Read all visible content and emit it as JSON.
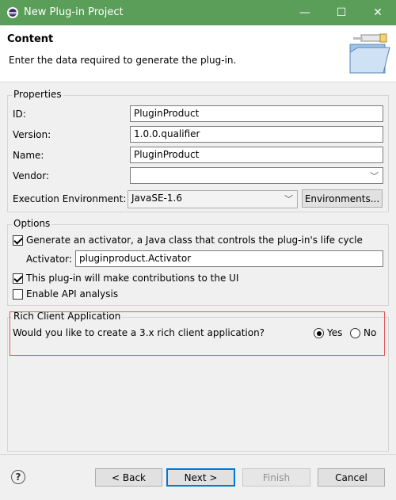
{
  "window": {
    "title": "New Plug-in Project",
    "minimize_glyph": "—",
    "maximize_glyph": "☐",
    "close_glyph": "✕"
  },
  "header": {
    "title": "Content",
    "description": "Enter the data required to generate the plug-in."
  },
  "properties": {
    "legend": "Properties",
    "id_label": "ID:",
    "id_value": "PluginProduct",
    "version_label": "Version:",
    "version_value": "1.0.0.qualifier",
    "name_label": "Name:",
    "name_value": "PluginProduct",
    "vendor_label": "Vendor:",
    "vendor_value": "",
    "exec_env_label": "Execution Environment:",
    "exec_env_value": "JavaSE-1.6",
    "environments_button": "Environments..."
  },
  "options": {
    "legend": "Options",
    "generate_activator_label": "Generate an activator, a Java class that controls the plug-in's life cycle",
    "generate_activator_checked": true,
    "activator_label": "Activator:",
    "activator_value": "pluginproduct.Activator",
    "ui_contrib_label": "This plug-in will make contributions to the UI",
    "ui_contrib_checked": true,
    "api_analysis_label": "Enable API analysis",
    "api_analysis_checked": false
  },
  "rcp": {
    "legend": "Rich Client Application",
    "question": "Would you like to create a 3.x rich client application?",
    "yes_label": "Yes",
    "no_label": "No",
    "selected": "Yes"
  },
  "footer": {
    "help_glyph": "?",
    "back_button": "< Back",
    "next_button": "Next >",
    "finish_button": "Finish",
    "cancel_button": "Cancel"
  },
  "colors": {
    "titlebar": "#5a9e5a",
    "highlight": "#e05a5a",
    "default_button_border": "#0078d7"
  }
}
